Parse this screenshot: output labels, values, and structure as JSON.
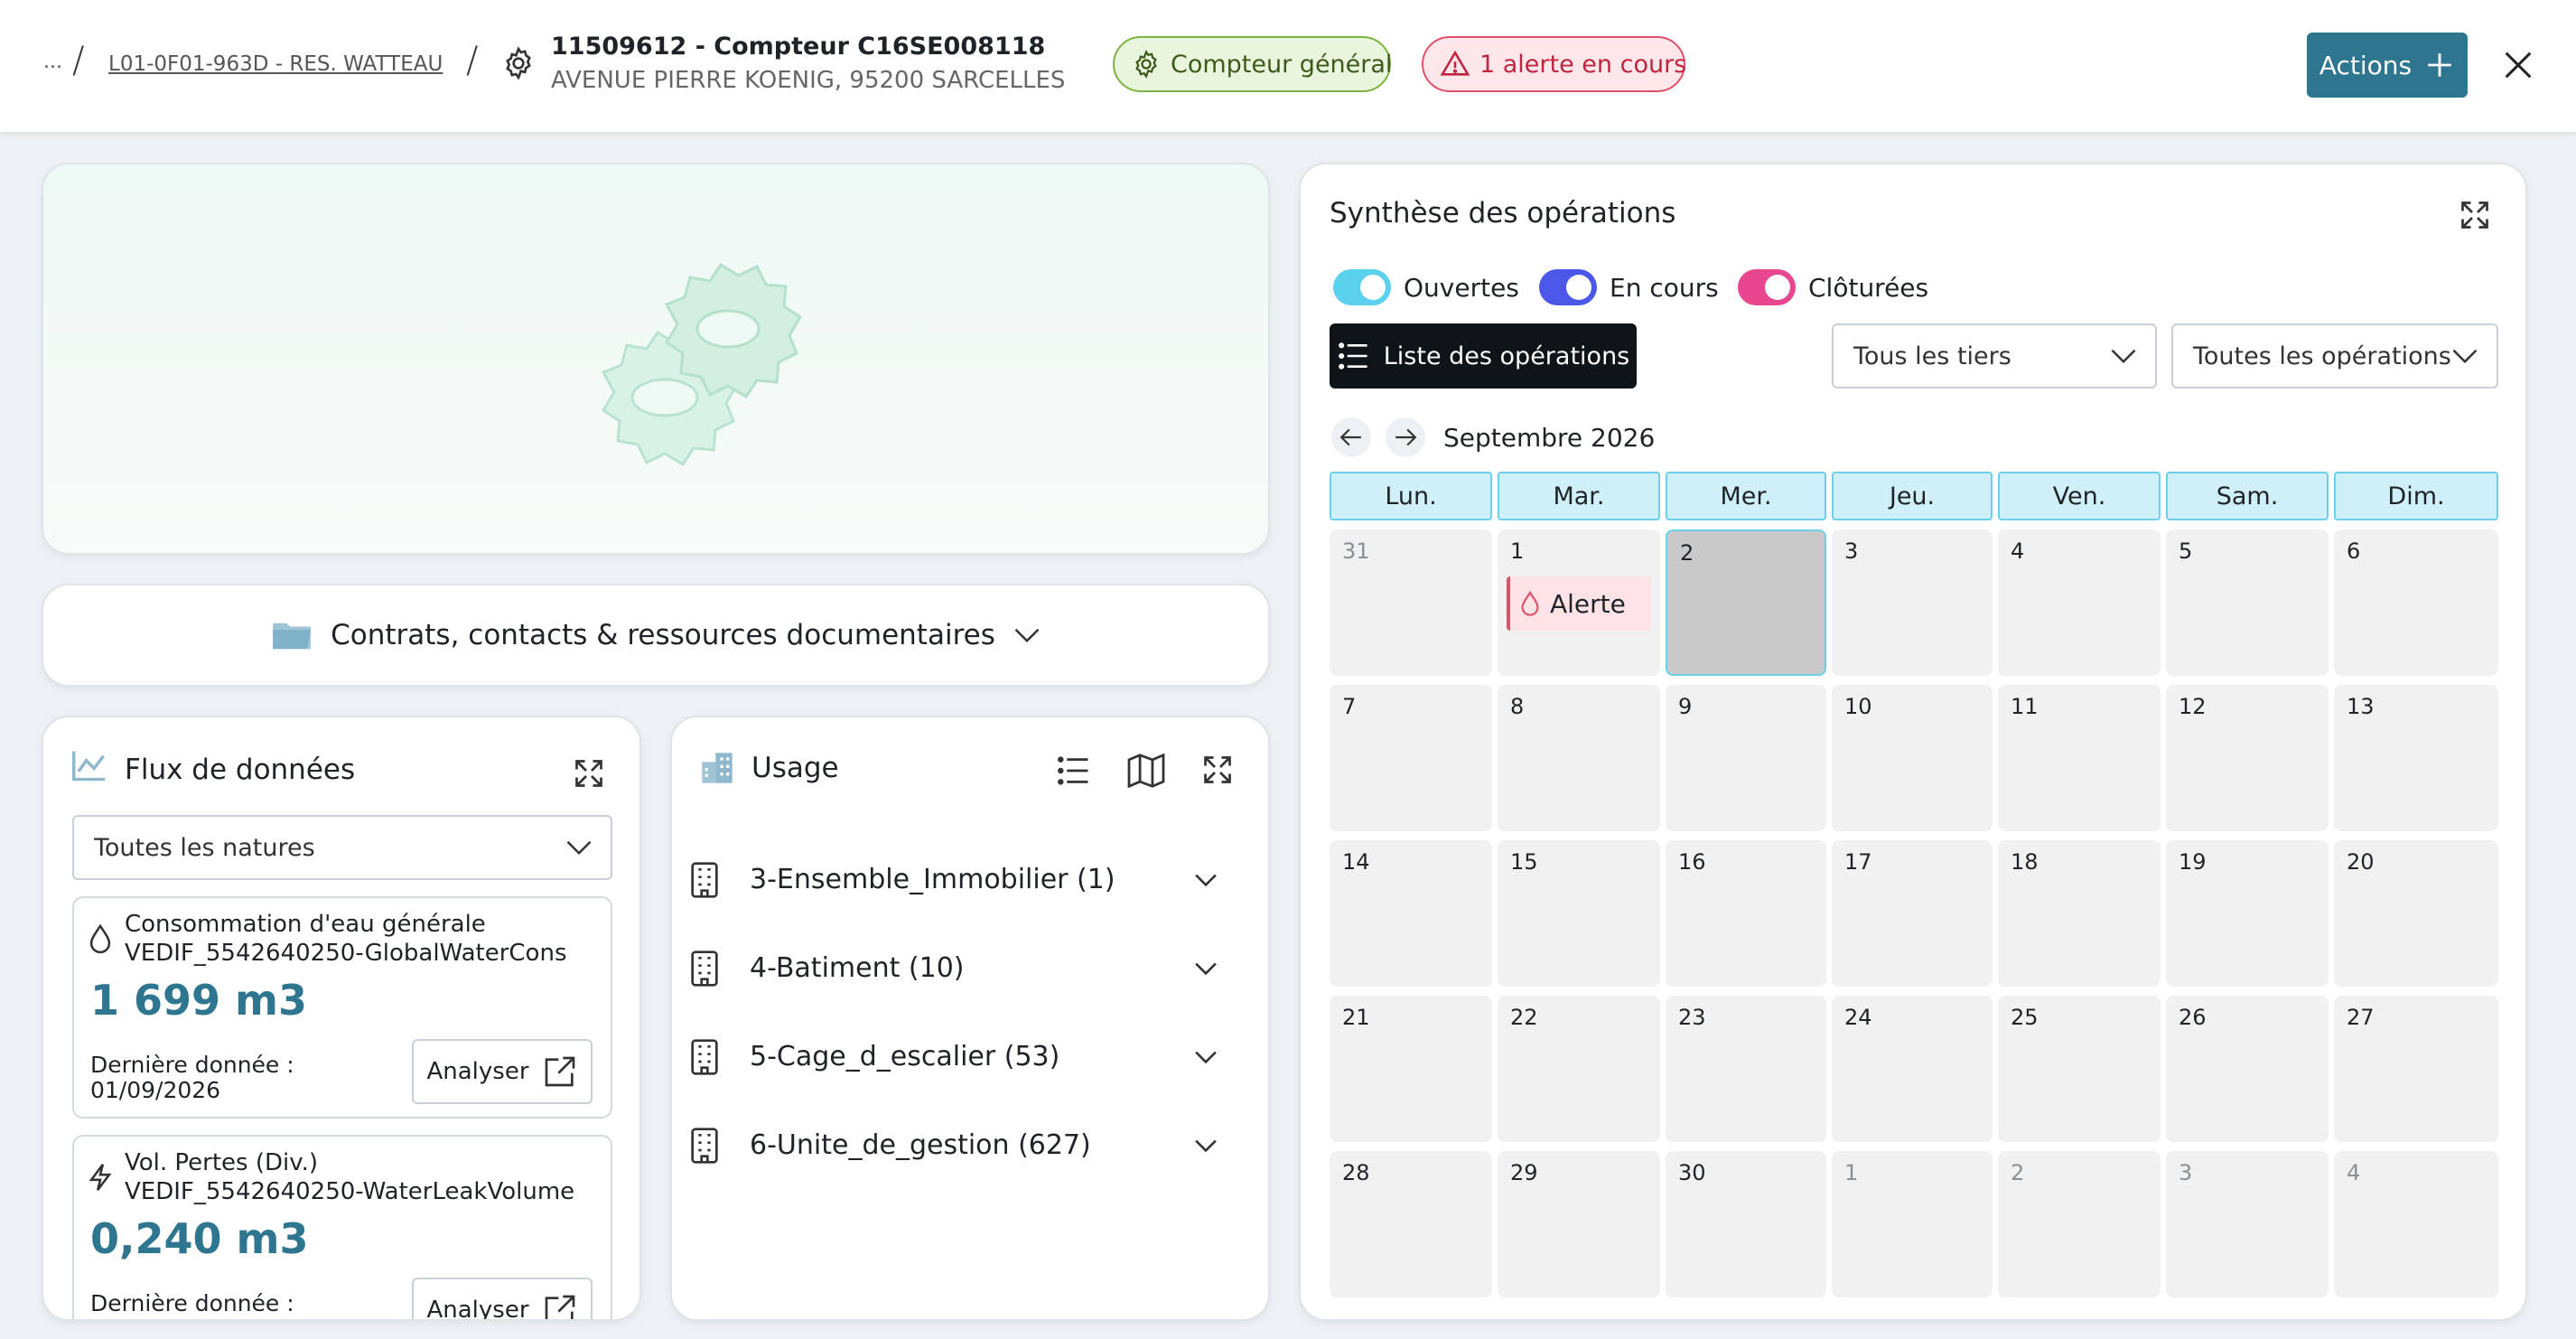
{
  "header": {
    "ellipsis": "...",
    "breadcrumb_link": "L01-0F01-963D - RES. WATTEAU",
    "title": "11509612 - Compteur C16SE008118",
    "address": "AVENUE PIERRE KOENIG, 95200 SARCELLES",
    "badge_general": "Compteur général",
    "badge_alert": "1 alerte en cours",
    "actions_label": "Actions"
  },
  "docs": {
    "label": "Contrats, contacts & ressources documentaires"
  },
  "flux": {
    "title": "Flux de données",
    "filter": "Toutes les natures",
    "items": [
      {
        "name": "Consommation d'eau générale",
        "code": "VEDIF_5542640250-GlobalWaterCons",
        "value": "1 699 m3",
        "last_label": "Dernière donnée :",
        "last_date": "01/09/2026",
        "button": "Analyser",
        "icon": "water-drop-icon"
      },
      {
        "name": "Vol. Pertes (Div.)",
        "code": "VEDIF_5542640250-WaterLeakVolume",
        "value": "0,240 m3",
        "last_label": "Dernière donnée :",
        "last_date": "",
        "button": "Analyser",
        "icon": "lightning-icon"
      }
    ]
  },
  "usage": {
    "title": "Usage",
    "rows": [
      {
        "label": "3-Ensemble_Immobilier (1)"
      },
      {
        "label": "4-Batiment (10)"
      },
      {
        "label": "5-Cage_d_escalier (53)"
      },
      {
        "label": "6-Unite_de_gestion (627)"
      }
    ]
  },
  "synthese": {
    "title": "Synthèse des opérations",
    "toggles": [
      {
        "label": "Ouvertes",
        "color": "#5bd1ee"
      },
      {
        "label": "En cours",
        "color": "#4a57e8"
      },
      {
        "label": "Clôturées",
        "color": "#e8478f"
      }
    ],
    "list_button": "Liste des opérations",
    "filter_tiers": "Tous les tiers",
    "filter_ops": "Toutes les opérations",
    "month": "Septembre 2026",
    "weekdays": [
      "Lun.",
      "Mar.",
      "Mer.",
      "Jeu.",
      "Ven.",
      "Sam.",
      "Dim."
    ],
    "days": [
      [
        "31",
        "1",
        "2",
        "3",
        "4",
        "5",
        "6"
      ],
      [
        "7",
        "8",
        "9",
        "10",
        "11",
        "12",
        "13"
      ],
      [
        "14",
        "15",
        "16",
        "17",
        "18",
        "19",
        "20"
      ],
      [
        "21",
        "22",
        "23",
        "24",
        "25",
        "26",
        "27"
      ],
      [
        "28",
        "29",
        "30",
        "1",
        "2",
        "3",
        "4"
      ]
    ],
    "alert_label": "Alerte"
  },
  "colors": {
    "accent": "#2e7590",
    "alert": "#e0506a",
    "general": "#7cb342",
    "calendar_head": "#cff0f8"
  }
}
